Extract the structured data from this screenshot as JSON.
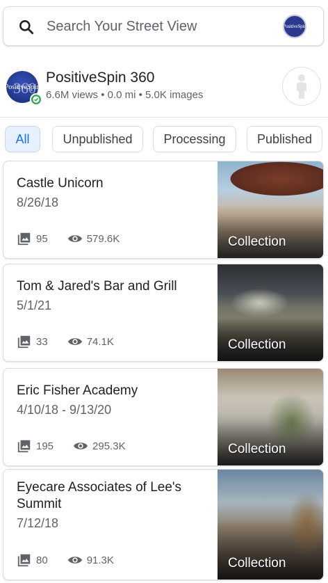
{
  "search": {
    "placeholder": "Search Your Street View",
    "avatar_text": "PositiveSpin"
  },
  "profile": {
    "name": "PositiveSpin 360",
    "stats": "6.6M views • 0.0 mi • 5.0K images",
    "avatar_text": "PositiveSpin",
    "avatar_bg_text": "360"
  },
  "filters": [
    "All",
    "Unpublished",
    "Processing",
    "Published"
  ],
  "cards": [
    {
      "title": "Castle Unicorn",
      "date": "8/26/18",
      "images": "95",
      "views": "579.6K",
      "label": "Collection"
    },
    {
      "title": "Tom & Jared's Bar and Grill",
      "date": "5/1/21",
      "images": "33",
      "views": "74.1K",
      "label": "Collection"
    },
    {
      "title": "Eric Fisher Academy",
      "date": "4/10/18 - 9/13/20",
      "images": "195",
      "views": "295.3K",
      "label": "Collection"
    },
    {
      "title": "Eyecare Associates of Lee's Summit",
      "date": "7/12/18",
      "images": "80",
      "views": "91.3K",
      "label": "Collection"
    }
  ],
  "colors": {
    "accent": "#1a73e8",
    "chip_active_bg": "#e8f0fe",
    "verified": "#34a853"
  }
}
